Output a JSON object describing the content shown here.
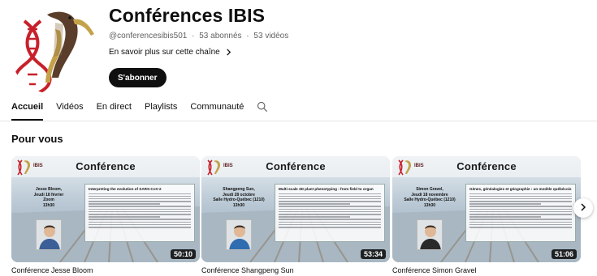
{
  "channel": {
    "name": "Conférences IBIS",
    "handle": "@conferencesibis501",
    "separator": "·",
    "subscribers": "53 abonnés",
    "videos_count": "53 vidéos",
    "more_label": "En savoir plus sur cette chaîne",
    "subscribe_label": "S'abonner",
    "logo_text": "IBIS"
  },
  "tabs": [
    {
      "label": "Accueil",
      "active": true
    },
    {
      "label": "Vidéos",
      "active": false
    },
    {
      "label": "En direct",
      "active": false
    },
    {
      "label": "Playlists",
      "active": false
    },
    {
      "label": "Communauté",
      "active": false
    }
  ],
  "section": {
    "title": "Pour vous"
  },
  "videos": [
    {
      "title": "Conférence Jesse Bloom",
      "duration": "50:10",
      "thumb_heading": "Conférence",
      "speaker_name": "Jesse Bloom,",
      "speaker_date": "Jeudi 18 février",
      "speaker_place": "Zoom",
      "speaker_time": "13h30",
      "abstract_title": "Interpreting the evolution of SARS-CoV-2",
      "shirt": "#3b5f96"
    },
    {
      "title": "Conférence Shangpeng Sun",
      "duration": "53:34",
      "thumb_heading": "Conférence",
      "speaker_name": "Shangpeng Sun,",
      "speaker_date": "Jeudi 28 octobre",
      "speaker_place": "Salle Hydro-Québec (1210)",
      "speaker_time": "13h30",
      "abstract_title": "Multi-scale 3D plant phenotyping : from field to organ",
      "shirt": "#2f6db0"
    },
    {
      "title": "Conférence Simon Gravel",
      "duration": "51:06",
      "thumb_heading": "Conférence",
      "speaker_name": "Simon Gravel,",
      "speaker_date": "Jeudi 18 novembre",
      "speaker_place": "Salle Hydro-Québec (1210)",
      "speaker_time": "13h30",
      "abstract_title": "Gènes, généalogies et géographie : un modèle québécois",
      "shirt": "#2a2a2a"
    }
  ],
  "colors": {
    "text": "#0f0f0f",
    "muted": "#606060",
    "subscribe_bg": "#0f0f0f",
    "ibis_red": "#c8202a",
    "ibis_gold": "#c4a24a"
  },
  "icons": {
    "search": "search-icon",
    "more": "chevron-right-icon",
    "next": "chevron-right-icon"
  }
}
